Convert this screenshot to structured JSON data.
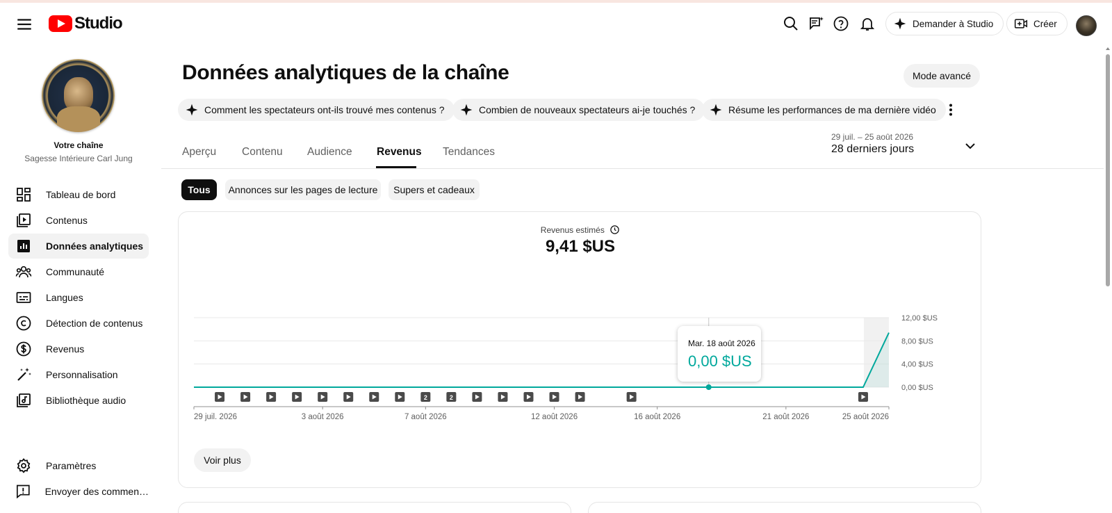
{
  "app": {
    "logo_text": "Studio"
  },
  "header": {
    "ask_studio_label": "Demander à Studio",
    "create_label": "Créer"
  },
  "sidebar": {
    "channel_label": "Votre chaîne",
    "channel_name": "Sagesse Intérieure Carl Jung",
    "items": [
      {
        "label": "Tableau de bord",
        "icon": "dashboard-icon"
      },
      {
        "label": "Contenus",
        "icon": "content-icon"
      },
      {
        "label": "Données analytiques",
        "icon": "analytics-icon",
        "active": true
      },
      {
        "label": "Communauté",
        "icon": "community-icon"
      },
      {
        "label": "Langues",
        "icon": "subtitles-icon"
      },
      {
        "label": "Détection de contenus",
        "icon": "copyright-icon"
      },
      {
        "label": "Revenus",
        "icon": "dollar-icon"
      },
      {
        "label": "Personnalisation",
        "icon": "magic-wand-icon"
      },
      {
        "label": "Bibliothèque audio",
        "icon": "audio-library-icon"
      }
    ],
    "bottom_items": [
      {
        "label": "Paramètres",
        "icon": "gear-icon"
      },
      {
        "label": "Envoyer des commen…",
        "icon": "feedback-icon"
      }
    ]
  },
  "main": {
    "title": "Données analytiques de la chaîne",
    "advanced_mode_label": "Mode avancé",
    "questions": [
      "Comment les spectateurs ont-ils trouvé mes contenus ?",
      "Combien de nouveaux spectateurs ai-je touchés ?",
      "Résume les performances de ma dernière vidéo"
    ],
    "tabs": [
      "Aperçu",
      "Contenu",
      "Audience",
      "Revenus",
      "Tendances"
    ],
    "active_tab": "Revenus",
    "date_range": {
      "dates": "29 juil. – 25 août 2026",
      "label": "28 derniers jours"
    },
    "filters": [
      "Tous",
      "Annonces sur les pages de lecture",
      "Supers et cadeaux"
    ],
    "active_filter": "Tous",
    "metric": {
      "label": "Revenus estimés",
      "value": "9,41 $US"
    },
    "tooltip": {
      "date": "Mar. 18 août 2026",
      "value": "0,00 $US"
    },
    "see_more_label": "Voir plus"
  },
  "colors": {
    "accent": "#00a89c",
    "brand_red": "#ff0000"
  },
  "chart_data": {
    "type": "line",
    "ylim": [
      0,
      12
    ],
    "y_ticks": [
      "12,00 $US",
      "8,00 $US",
      "4,00 $US",
      "0,00 $US"
    ],
    "y_tick_values": [
      12,
      8,
      4,
      0
    ],
    "x_ticks": [
      "29 juil. 2026",
      "3 août 2026",
      "7 août 2026",
      "12 août 2026",
      "16 août 2026",
      "21 août 2026",
      "25 août 2026"
    ],
    "x_tick_days": [
      0,
      5,
      9,
      14,
      18,
      23,
      27
    ],
    "series": [
      {
        "values": [
          0,
          0,
          0,
          0,
          0,
          0,
          0,
          0,
          0,
          0,
          0,
          0,
          0,
          0,
          0,
          0,
          0,
          0,
          0,
          0,
          0,
          0,
          0,
          0,
          0,
          0,
          0,
          9.41
        ]
      }
    ],
    "highlight_day": 20,
    "partial_last_day": true,
    "video_markers": [
      {
        "day": 1,
        "label": ""
      },
      {
        "day": 2,
        "label": ""
      },
      {
        "day": 3,
        "label": ""
      },
      {
        "day": 4,
        "label": ""
      },
      {
        "day": 5,
        "label": ""
      },
      {
        "day": 6,
        "label": ""
      },
      {
        "day": 7,
        "label": ""
      },
      {
        "day": 8,
        "label": ""
      },
      {
        "day": 9,
        "label": "2"
      },
      {
        "day": 10,
        "label": "2"
      },
      {
        "day": 11,
        "label": ""
      },
      {
        "day": 12,
        "label": ""
      },
      {
        "day": 13,
        "label": ""
      },
      {
        "day": 14,
        "label": ""
      },
      {
        "day": 15,
        "label": ""
      },
      {
        "day": 17,
        "label": ""
      },
      {
        "day": 26,
        "label": ""
      }
    ],
    "grid": true
  }
}
